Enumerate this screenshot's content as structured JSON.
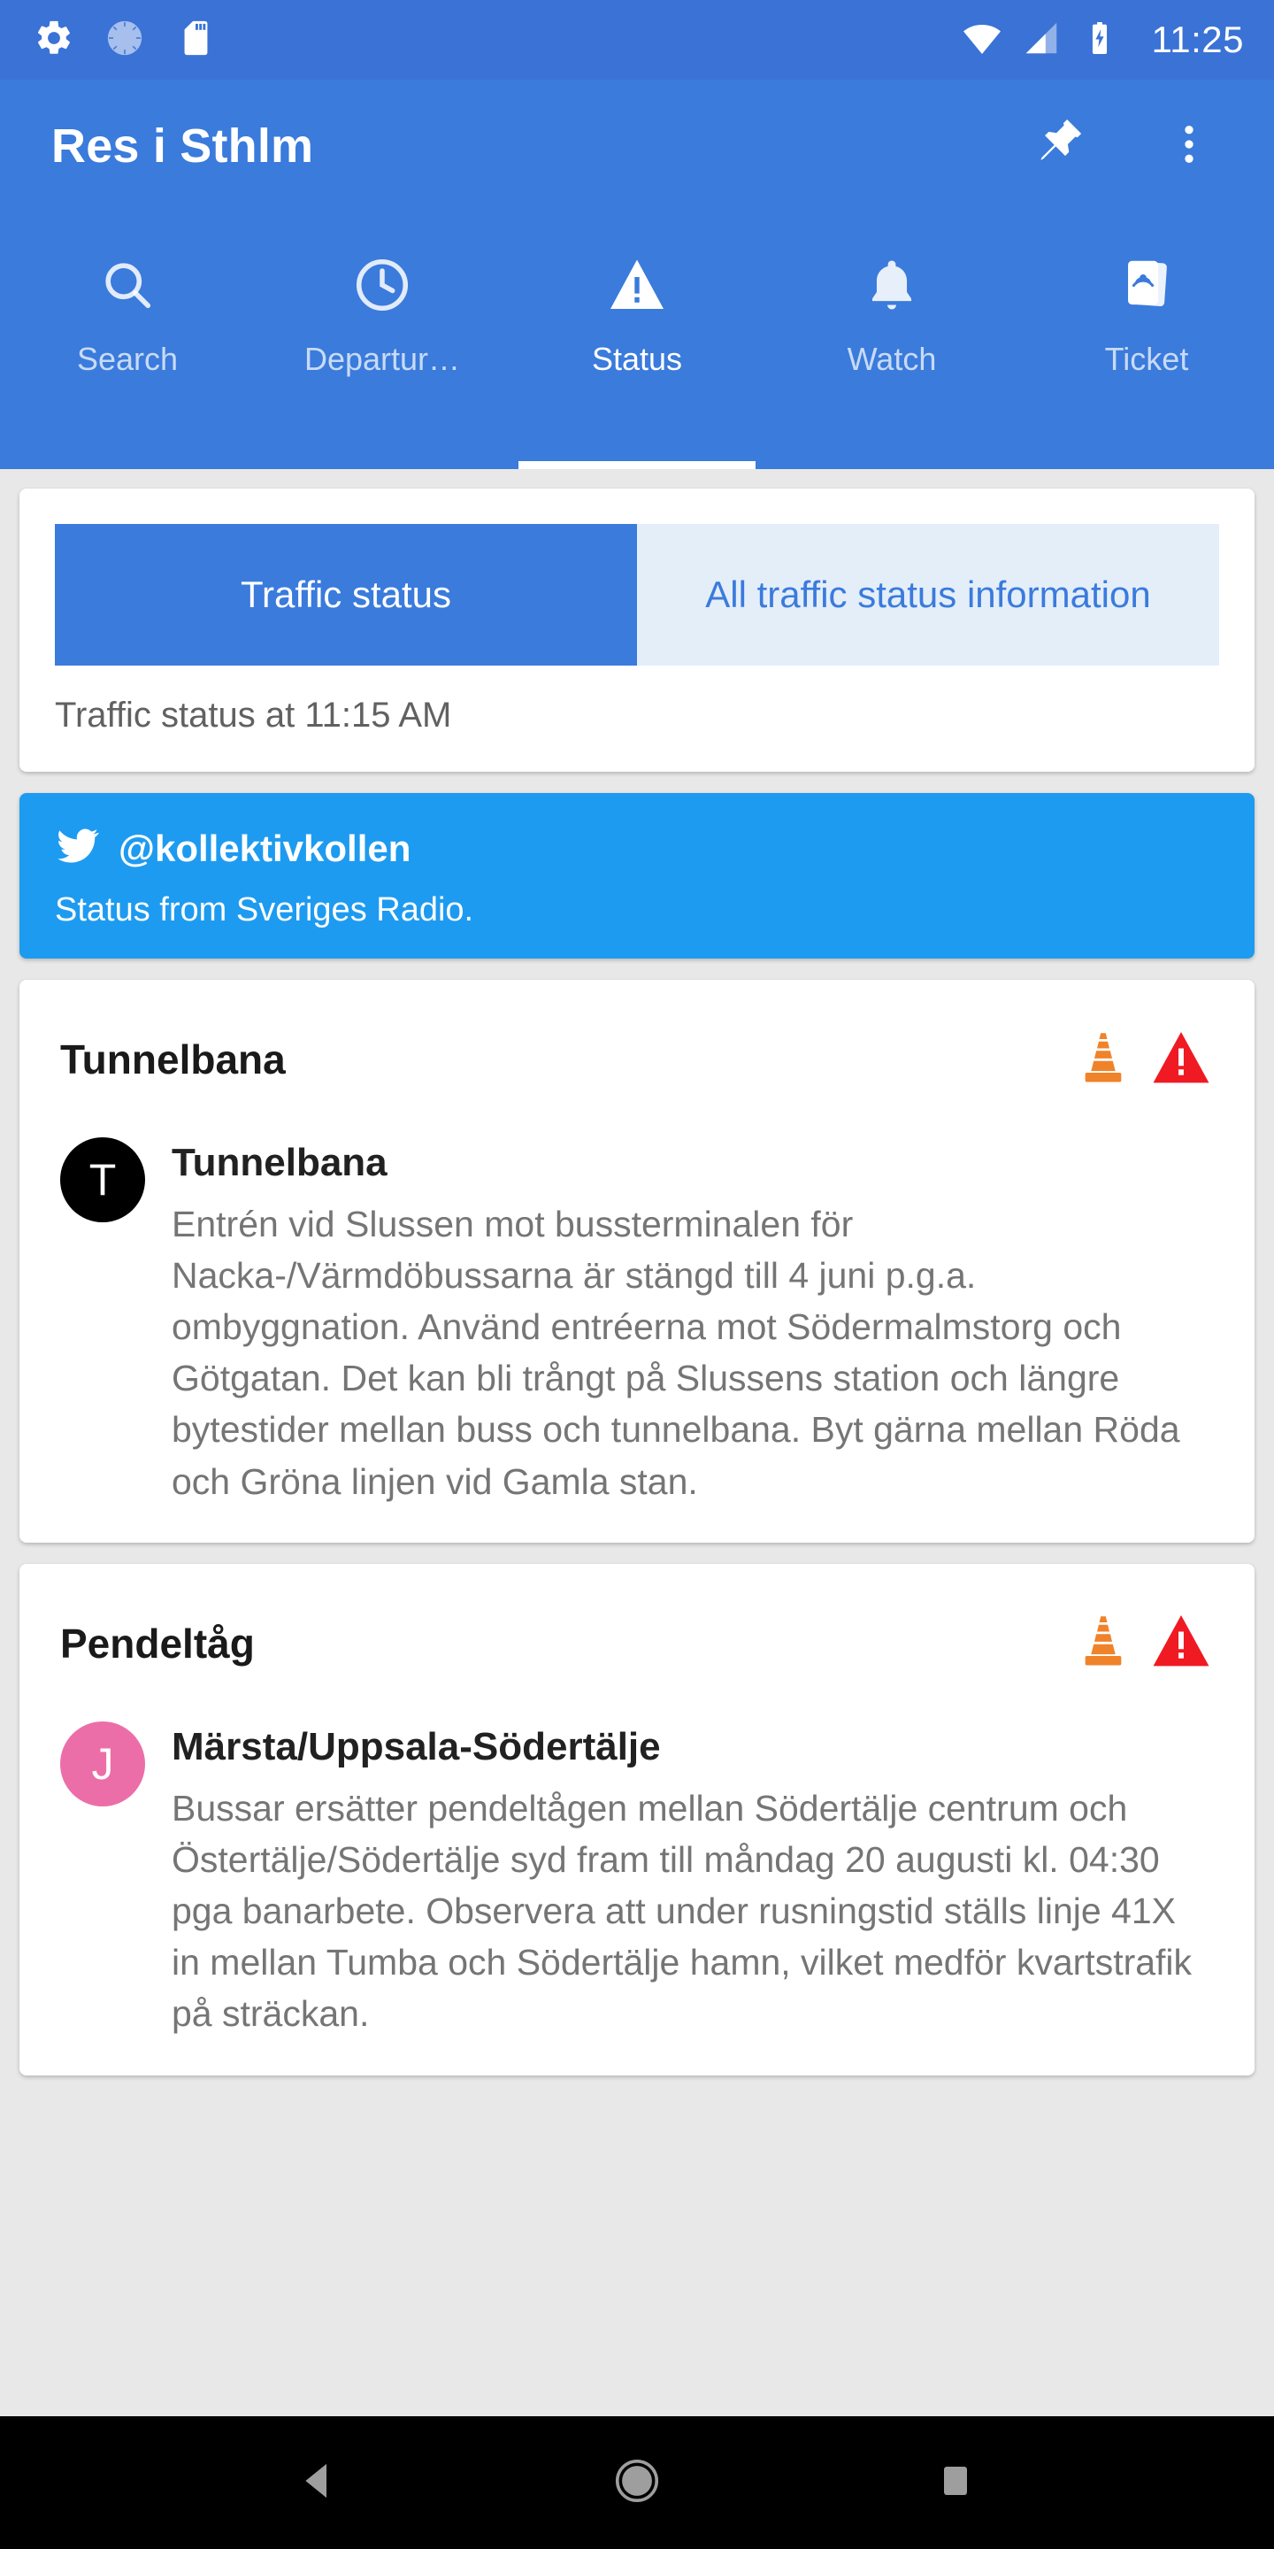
{
  "status_bar": {
    "left_icons": [
      "settings-gear-icon",
      "brightness-circle-icon",
      "sd-card-icon"
    ],
    "right_icons": [
      "wifi-icon",
      "cell-signal-icon",
      "battery-charging-icon"
    ],
    "clock": "11:25"
  },
  "app_bar": {
    "title": "Res i Sthlm",
    "pin_icon": "pushpin-icon",
    "overflow_icon": "overflow-menu-icon"
  },
  "tabs": [
    {
      "label": "Search",
      "icon": "search-icon",
      "active": false
    },
    {
      "label": "Departur…",
      "icon": "clock-icon",
      "active": false
    },
    {
      "label": "Status",
      "icon": "warning-triangle-icon",
      "active": true
    },
    {
      "label": "Watch",
      "icon": "bell-icon",
      "active": false
    },
    {
      "label": "Ticket",
      "icon": "ticket-cards-icon",
      "active": false
    }
  ],
  "toggle_card": {
    "segments": [
      {
        "label": "Traffic status",
        "active": true
      },
      {
        "label": "All traffic status information",
        "active": false
      }
    ],
    "subtitle": "Traffic status at 11:15 AM"
  },
  "twitter_banner": {
    "icon": "twitter-bird-icon",
    "handle": "@kollektivkollen",
    "subtitle": "Status from Sveriges Radio."
  },
  "status_cards": [
    {
      "title": "Tunnelbana",
      "icons": [
        "traffic-cone-icon",
        "warning-triangle-icon"
      ],
      "deviations": [
        {
          "badge_letter": "T",
          "badge_color": "#000000",
          "title": "Tunnelbana",
          "text": "Entrén vid Slussen mot bussterminalen för Nacka-/Värmdöbussarna är stängd till 4 juni p.g.a. ombyggnation. Använd entréerna mot Södermalmstorg och Götgatan. Det kan bli trångt på Slussens station och längre bytestider mellan buss och tunnelbana. Byt gärna mellan Röda och Gröna linjen vid Gamla stan."
        }
      ]
    },
    {
      "title": "Pendeltåg",
      "icons": [
        "traffic-cone-icon",
        "warning-triangle-icon"
      ],
      "deviations": [
        {
          "badge_letter": "J",
          "badge_color": "#EC6EA8",
          "title": "Märsta/Uppsala-Södertälje",
          "text": "Bussar ersätter pendeltågen mellan Södertälje centrum och Östertälje/Södertälje syd fram till måndag 20 augusti kl. 04:30 pga banarbete. Observera att under rusningstid ställs linje 41X in mellan Tumba och Södertälje hamn, vilket medför kvartstrafik på sträckan."
        }
      ]
    }
  ],
  "nav_bar": {
    "back_icon": "back-triangle-icon",
    "home_icon": "home-circle-icon",
    "recents_icon": "recents-square-icon"
  },
  "colors": {
    "primary_blue": "#3A7BDC",
    "status_bar_blue": "#3A72D6",
    "twitter_blue": "#1D9BF0",
    "segment_inactive_bg": "#E4EEF9",
    "page_bg": "#E8E8E8",
    "cone_orange": "#F0822A",
    "warning_red": "#F01A23",
    "metro_badge": "#000000",
    "commuter_badge": "#EC6EA8"
  }
}
